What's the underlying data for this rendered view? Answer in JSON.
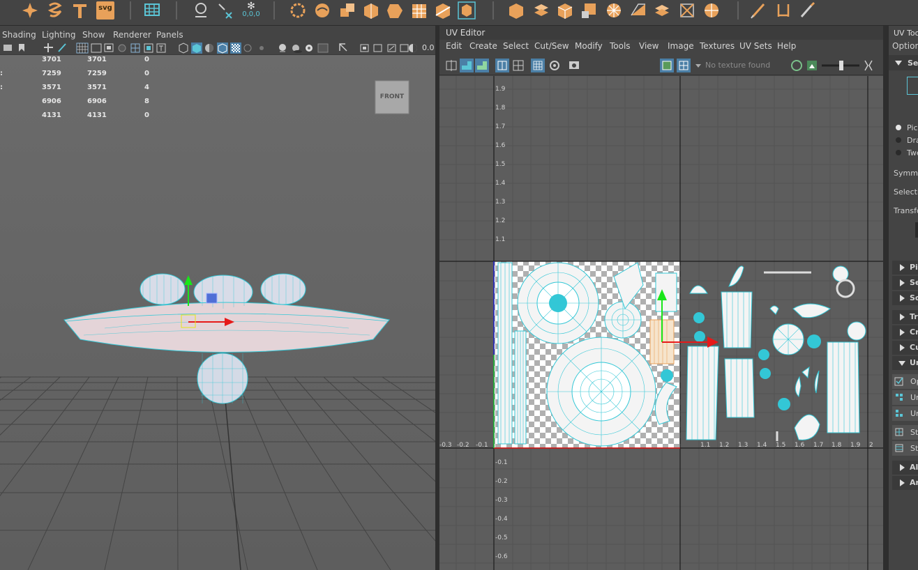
{
  "shelf": {
    "icons": [
      "sparkle-icon",
      "spiral-icon",
      "text-tool-icon",
      "svg-tool-icon",
      "grid-tool-icon",
      "curve-tool-icon",
      "coordinate-tool-icon",
      "snowflake-tool-icon",
      "lasso-tool-icon",
      "bridge-tool-icon",
      "boolean-tool-icon",
      "extrude-icon",
      "sphere-icon",
      "mesh-icon",
      "split-icon",
      "mirror-icon",
      "combine-icon",
      "poly-extrude-icon",
      "poly-stack-icon",
      "poly-cube-icon",
      "poly-face-icon",
      "poly-wheel-icon",
      "poly-bevel-icon",
      "poly-plane-icon",
      "poly-grid-icon",
      "poly-smooth-icon",
      "pen-tool-icon",
      "ruler-tool-icon",
      "brush-tool-icon"
    ],
    "svg_label": "svg",
    "coord_label": "0,0,0"
  },
  "viewport": {
    "menu": [
      "Shading",
      "Lighting",
      "Show",
      "Renderer",
      "Panels"
    ],
    "toolbar_value": "0.0",
    "view_cube_label": "FRONT",
    "hud": [
      {
        "prefix": "",
        "a": "3701",
        "b": "3701",
        "c": "0"
      },
      {
        "prefix": ":",
        "a": "7259",
        "b": "7259",
        "c": "0"
      },
      {
        "prefix": ":",
        "a": "3571",
        "b": "3571",
        "c": "4"
      },
      {
        "prefix": "",
        "a": "6906",
        "b": "6906",
        "c": "8"
      },
      {
        "prefix": "",
        "a": "4131",
        "b": "4131",
        "c": "0"
      }
    ]
  },
  "uv_editor": {
    "title": "UV Editor",
    "menu": [
      "Edit",
      "Create",
      "Select",
      "Cut/Sew",
      "Modify",
      "Tools",
      "View",
      "Image",
      "Textures",
      "UV Sets",
      "Help"
    ],
    "texture_status": "No texture found",
    "v_labels": [
      "1.9",
      "1.8",
      "1.7",
      "1.6",
      "1.5",
      "1.4",
      "1.3",
      "1.2",
      "1.1",
      "-0.1",
      "-0.2",
      "-0.3",
      "-0.4",
      "-0.5",
      "-0.6"
    ],
    "u_labels_neg": [
      "-0.3",
      "-0.2",
      "-0.1"
    ],
    "u_labels_pos": [
      "1.1",
      "1.2",
      "1.3",
      "1.4",
      "1.5",
      "1.6",
      "1.7",
      "1.8",
      "1.9",
      "2"
    ]
  },
  "tools_panel": {
    "title": "UV Toolkit",
    "options_label": "Options",
    "section_select": "Selection",
    "radio_options": [
      "Pick",
      "Drag",
      "Tweak"
    ],
    "symmetry_label": "Symmetry",
    "selection_label": "Selection",
    "transform_label": "Transform",
    "collapsed_sections_a": [
      "Pin",
      "Select",
      "Soft Selection"
    ],
    "collapsed_sections_b": [
      "Transform",
      "Create",
      "Cut and Sew"
    ],
    "unfold_section": "Unfold",
    "unfold_buttons": [
      "Optimize",
      "Unfold",
      "Unfold"
    ],
    "straighten_buttons": [
      "Straighten",
      "Straighten"
    ],
    "collapsed_sections_c": [
      "Align and Snap",
      "Arrange and Layout"
    ]
  },
  "colors": {
    "wireframe": "#33c7d6",
    "accent_orange": "#e8a15a",
    "uv_grid_bg": "#5d5d5d",
    "viewport_bg": "#6a6a6a"
  }
}
